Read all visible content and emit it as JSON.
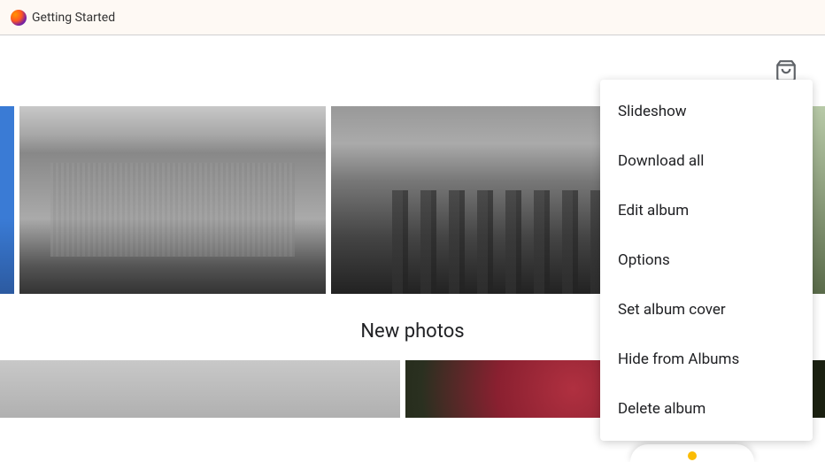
{
  "bookmark_bar": {
    "items": [
      {
        "label": "Getting Started",
        "icon": "firefox-icon"
      }
    ]
  },
  "toolbar": {
    "shopping_icon": "shopping-bag-icon"
  },
  "dropdown": {
    "items": [
      {
        "label": "Slideshow"
      },
      {
        "label": "Download all"
      },
      {
        "label": "Edit album"
      },
      {
        "label": "Options"
      },
      {
        "label": "Set album cover"
      },
      {
        "label": "Hide from Albums"
      },
      {
        "label": "Delete album"
      }
    ]
  },
  "sections": {
    "new_photos_title": "New photos"
  }
}
